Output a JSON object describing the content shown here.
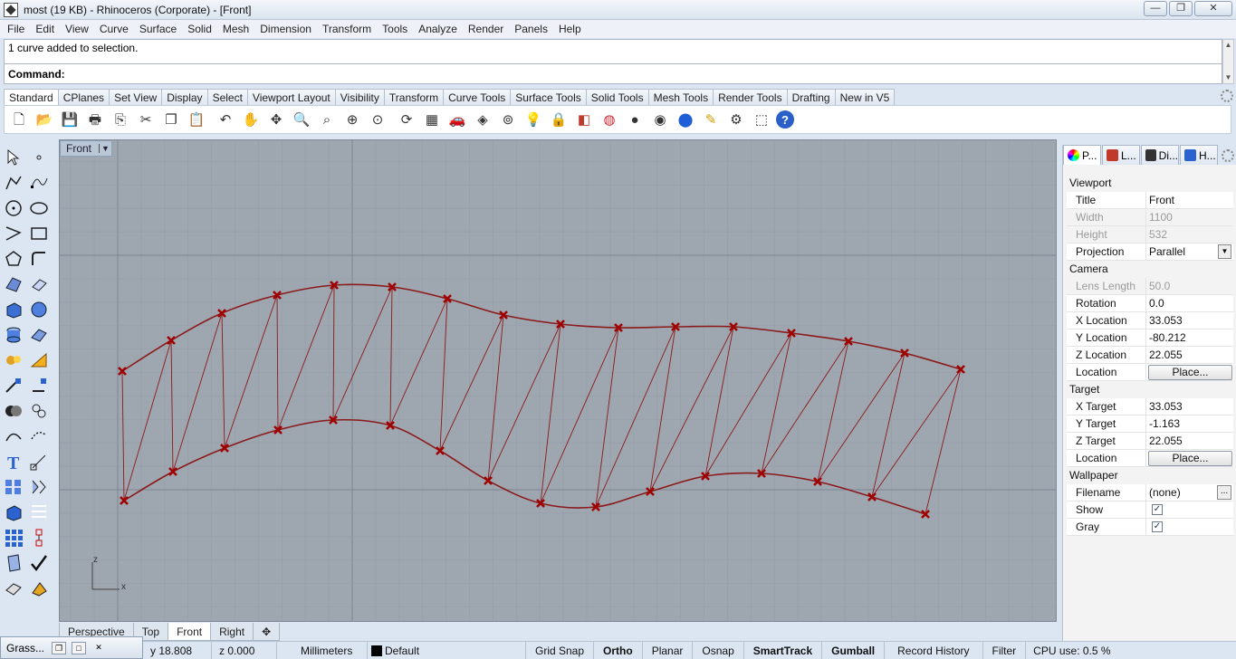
{
  "window": {
    "title": "most (19 KB) - Rhinoceros (Corporate) - [Front]"
  },
  "menu": [
    "File",
    "Edit",
    "View",
    "Curve",
    "Surface",
    "Solid",
    "Mesh",
    "Dimension",
    "Transform",
    "Tools",
    "Analyze",
    "Render",
    "Panels",
    "Help"
  ],
  "command": {
    "history": "1 curve added to selection.",
    "prompt": "Command:"
  },
  "toolbar_tabs": [
    "Standard",
    "CPlanes",
    "Set View",
    "Display",
    "Select",
    "Viewport Layout",
    "Visibility",
    "Transform",
    "Curve Tools",
    "Surface Tools",
    "Solid Tools",
    "Mesh Tools",
    "Render Tools",
    "Drafting",
    "New in V5"
  ],
  "toolbar_icons": [
    "new-file-icon",
    "open-file-icon",
    "save-icon",
    "print-icon",
    "import-icon",
    "cut-icon",
    "copy-icon",
    "paste-icon",
    "undo-icon",
    "pan-hand-icon",
    "rotate-view-icon",
    "zoom-icon",
    "zoom-window-icon",
    "zoom-extents-icon",
    "zoom-selected-icon",
    "rotate-camera-icon",
    "four-viewports-icon",
    "car-icon",
    "cplane-icon",
    "snap-icon",
    "lightbulb-icon",
    "lock-icon",
    "layer-icon",
    "color-wheel-icon",
    "shaded-sphere-icon",
    "rendered-sphere-icon",
    "blue-sphere-icon",
    "pen-icon",
    "gear-icon",
    "select-icon",
    "help-icon"
  ],
  "viewport": {
    "title": "Front",
    "axis_z": "z",
    "axis_x": "x"
  },
  "viewport_tabs": [
    "Perspective",
    "Top",
    "Front",
    "Right"
  ],
  "panel": {
    "tabs": [
      "P...",
      "L...",
      "Di...",
      "H..."
    ],
    "sections": [
      {
        "title": "Viewport",
        "rows": [
          {
            "key": "Title",
            "value": "Front"
          },
          {
            "key": "Width",
            "value": "1100",
            "disabled": true
          },
          {
            "key": "Height",
            "value": "532",
            "disabled": true
          },
          {
            "key": "Projection",
            "value": "Parallel",
            "select": true
          }
        ]
      },
      {
        "title": "Camera",
        "rows": [
          {
            "key": "Lens Length",
            "value": "50.0",
            "disabled": true
          },
          {
            "key": "Rotation",
            "value": "0.0"
          },
          {
            "key": "X Location",
            "value": "33.053"
          },
          {
            "key": "Y Location",
            "value": "-80.212"
          },
          {
            "key": "Z Location",
            "value": "22.055"
          },
          {
            "key": "Location",
            "value": "Place...",
            "button": true
          }
        ]
      },
      {
        "title": "Target",
        "rows": [
          {
            "key": "X Target",
            "value": "33.053"
          },
          {
            "key": "Y Target",
            "value": "-1.163"
          },
          {
            "key": "Z Target",
            "value": "22.055"
          },
          {
            "key": "Location",
            "value": "Place...",
            "button": true
          }
        ]
      },
      {
        "title": "Wallpaper",
        "rows": [
          {
            "key": "Filename",
            "value": "(none)",
            "browse": true
          },
          {
            "key": "Show",
            "value": "✓",
            "checkbox": true
          },
          {
            "key": "Gray",
            "value": "✓",
            "checkbox": true
          }
        ]
      }
    ]
  },
  "status": {
    "grasshopper": "Grass...",
    "y": "y 18.808",
    "z": "z 0.000",
    "units": "Millimeters",
    "layer": "Default",
    "toggles": [
      {
        "label": "Grid Snap",
        "bold": false
      },
      {
        "label": "Ortho",
        "bold": true
      },
      {
        "label": "Planar",
        "bold": false
      },
      {
        "label": "Osnap",
        "bold": false
      },
      {
        "label": "SmartTrack",
        "bold": true
      },
      {
        "label": "Gumball",
        "bold": true
      },
      {
        "label": "Record History",
        "bold": false
      },
      {
        "label": "Filter",
        "bold": false
      }
    ],
    "cpu": "CPU use: 0.5 %"
  },
  "colors": {
    "curve": "#8b1a1a",
    "point": "#a00000",
    "viewport_bg": "#9ea6b0"
  }
}
